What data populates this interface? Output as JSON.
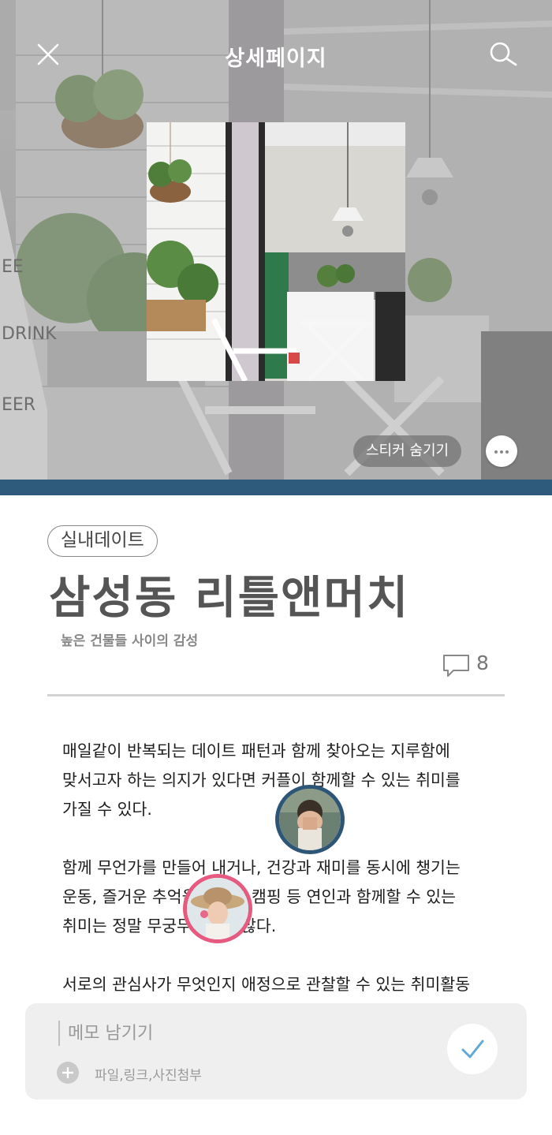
{
  "header": {
    "title": "상세페이지",
    "close_icon": "close-icon",
    "search_icon": "search-icon"
  },
  "hero": {
    "sticker_toggle_label": "스티커 숨기기",
    "more_icon": "more-horizontal-icon",
    "band_color": "#2e5a7b"
  },
  "article": {
    "category": "실내데이트",
    "title": "삼성동 리틀앤머치",
    "subtitle": "높은 건물들 사이의 감성",
    "comment_count": "8",
    "paragraphs": [
      [
        "매일같이 반복되는 데이트 패턴과 함께 찾아오는 지루함에",
        "맞서고자 하는 의지가 있다면 커플이 함께할 수 있는 취미를",
        "가질 수 있다."
      ],
      [
        "함께 무언가를 만들어 내거나, 건강과 재미를 동시에 챙기는",
        "운동, 즐거운 추억을 남겨줄 캠핑 등 연인과 함께할 수 있는",
        "취미는 정말 무궁무진하게 많다."
      ],
      [
        "서로의 관심사가 무엇인지 애정으로 관찰할 수 있는 취미활동"
      ]
    ]
  },
  "avatars": {
    "colors": [
      "#2d5576",
      "#e55a7e"
    ]
  },
  "memo": {
    "placeholder": "메모 남기기",
    "attach_label": "파일,링크,사진첨부",
    "submit_icon": "check-icon",
    "accent": "#5fa8d8"
  }
}
